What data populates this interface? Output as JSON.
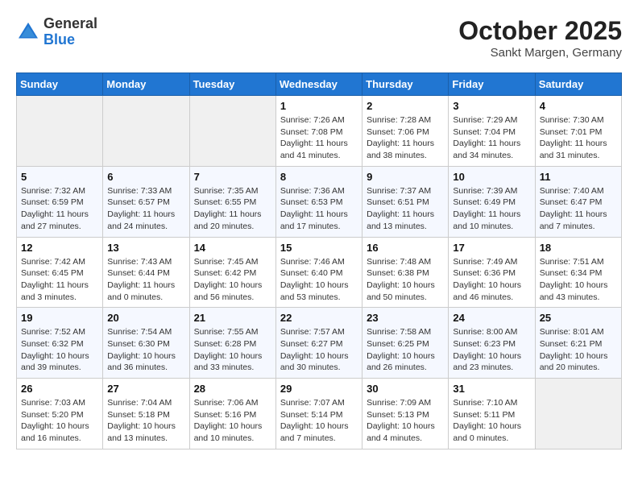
{
  "header": {
    "logo_general": "General",
    "logo_blue": "Blue",
    "month_title": "October 2025",
    "subtitle": "Sankt Margen, Germany"
  },
  "days_of_week": [
    "Sunday",
    "Monday",
    "Tuesday",
    "Wednesday",
    "Thursday",
    "Friday",
    "Saturday"
  ],
  "weeks": [
    [
      {
        "day": "",
        "info": ""
      },
      {
        "day": "",
        "info": ""
      },
      {
        "day": "",
        "info": ""
      },
      {
        "day": "1",
        "info": "Sunrise: 7:26 AM\nSunset: 7:08 PM\nDaylight: 11 hours and 41 minutes."
      },
      {
        "day": "2",
        "info": "Sunrise: 7:28 AM\nSunset: 7:06 PM\nDaylight: 11 hours and 38 minutes."
      },
      {
        "day": "3",
        "info": "Sunrise: 7:29 AM\nSunset: 7:04 PM\nDaylight: 11 hours and 34 minutes."
      },
      {
        "day": "4",
        "info": "Sunrise: 7:30 AM\nSunset: 7:01 PM\nDaylight: 11 hours and 31 minutes."
      }
    ],
    [
      {
        "day": "5",
        "info": "Sunrise: 7:32 AM\nSunset: 6:59 PM\nDaylight: 11 hours and 27 minutes."
      },
      {
        "day": "6",
        "info": "Sunrise: 7:33 AM\nSunset: 6:57 PM\nDaylight: 11 hours and 24 minutes."
      },
      {
        "day": "7",
        "info": "Sunrise: 7:35 AM\nSunset: 6:55 PM\nDaylight: 11 hours and 20 minutes."
      },
      {
        "day": "8",
        "info": "Sunrise: 7:36 AM\nSunset: 6:53 PM\nDaylight: 11 hours and 17 minutes."
      },
      {
        "day": "9",
        "info": "Sunrise: 7:37 AM\nSunset: 6:51 PM\nDaylight: 11 hours and 13 minutes."
      },
      {
        "day": "10",
        "info": "Sunrise: 7:39 AM\nSunset: 6:49 PM\nDaylight: 11 hours and 10 minutes."
      },
      {
        "day": "11",
        "info": "Sunrise: 7:40 AM\nSunset: 6:47 PM\nDaylight: 11 hours and 7 minutes."
      }
    ],
    [
      {
        "day": "12",
        "info": "Sunrise: 7:42 AM\nSunset: 6:45 PM\nDaylight: 11 hours and 3 minutes."
      },
      {
        "day": "13",
        "info": "Sunrise: 7:43 AM\nSunset: 6:44 PM\nDaylight: 11 hours and 0 minutes."
      },
      {
        "day": "14",
        "info": "Sunrise: 7:45 AM\nSunset: 6:42 PM\nDaylight: 10 hours and 56 minutes."
      },
      {
        "day": "15",
        "info": "Sunrise: 7:46 AM\nSunset: 6:40 PM\nDaylight: 10 hours and 53 minutes."
      },
      {
        "day": "16",
        "info": "Sunrise: 7:48 AM\nSunset: 6:38 PM\nDaylight: 10 hours and 50 minutes."
      },
      {
        "day": "17",
        "info": "Sunrise: 7:49 AM\nSunset: 6:36 PM\nDaylight: 10 hours and 46 minutes."
      },
      {
        "day": "18",
        "info": "Sunrise: 7:51 AM\nSunset: 6:34 PM\nDaylight: 10 hours and 43 minutes."
      }
    ],
    [
      {
        "day": "19",
        "info": "Sunrise: 7:52 AM\nSunset: 6:32 PM\nDaylight: 10 hours and 39 minutes."
      },
      {
        "day": "20",
        "info": "Sunrise: 7:54 AM\nSunset: 6:30 PM\nDaylight: 10 hours and 36 minutes."
      },
      {
        "day": "21",
        "info": "Sunrise: 7:55 AM\nSunset: 6:28 PM\nDaylight: 10 hours and 33 minutes."
      },
      {
        "day": "22",
        "info": "Sunrise: 7:57 AM\nSunset: 6:27 PM\nDaylight: 10 hours and 30 minutes."
      },
      {
        "day": "23",
        "info": "Sunrise: 7:58 AM\nSunset: 6:25 PM\nDaylight: 10 hours and 26 minutes."
      },
      {
        "day": "24",
        "info": "Sunrise: 8:00 AM\nSunset: 6:23 PM\nDaylight: 10 hours and 23 minutes."
      },
      {
        "day": "25",
        "info": "Sunrise: 8:01 AM\nSunset: 6:21 PM\nDaylight: 10 hours and 20 minutes."
      }
    ],
    [
      {
        "day": "26",
        "info": "Sunrise: 7:03 AM\nSunset: 5:20 PM\nDaylight: 10 hours and 16 minutes."
      },
      {
        "day": "27",
        "info": "Sunrise: 7:04 AM\nSunset: 5:18 PM\nDaylight: 10 hours and 13 minutes."
      },
      {
        "day": "28",
        "info": "Sunrise: 7:06 AM\nSunset: 5:16 PM\nDaylight: 10 hours and 10 minutes."
      },
      {
        "day": "29",
        "info": "Sunrise: 7:07 AM\nSunset: 5:14 PM\nDaylight: 10 hours and 7 minutes."
      },
      {
        "day": "30",
        "info": "Sunrise: 7:09 AM\nSunset: 5:13 PM\nDaylight: 10 hours and 4 minutes."
      },
      {
        "day": "31",
        "info": "Sunrise: 7:10 AM\nSunset: 5:11 PM\nDaylight: 10 hours and 0 minutes."
      },
      {
        "day": "",
        "info": ""
      }
    ]
  ]
}
